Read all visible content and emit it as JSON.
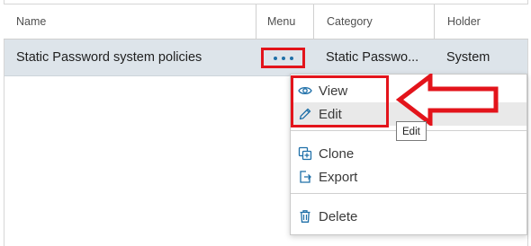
{
  "table": {
    "headers": {
      "name": "Name",
      "menu": "Menu",
      "category": "Category",
      "holder": "Holder"
    },
    "rows": [
      {
        "name": "Static Password system policies",
        "category": "Static Passwo...",
        "holder": "System"
      }
    ]
  },
  "row_menu": {
    "trigger_icon": "ellipsis-icon",
    "items": [
      {
        "label": "View",
        "icon": "eye-icon"
      },
      {
        "label": "Edit",
        "icon": "pencil-icon"
      },
      {
        "label": "Clone",
        "icon": "clone-icon"
      },
      {
        "label": "Export",
        "icon": "export-icon"
      },
      {
        "label": "Delete",
        "icon": "trash-icon"
      }
    ],
    "tooltip": "Edit"
  },
  "colors": {
    "annotation_red": "#e3141b",
    "selected_row": "#dde4ea",
    "icon_blue": "#1e6fa8",
    "hover_item": "#e9e9e9"
  }
}
